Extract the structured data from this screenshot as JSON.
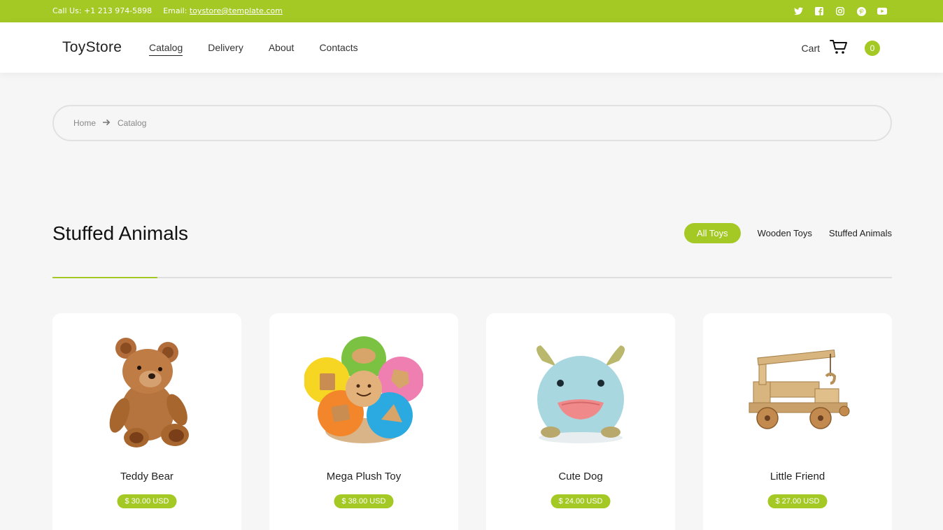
{
  "topbar": {
    "call_label": "Call Us: +1 213 974-5898",
    "email_prefix": "Email:",
    "email": "toystore@template.com",
    "social": [
      "twitter-icon",
      "facebook-icon",
      "instagram-icon",
      "pinterest-icon",
      "youtube-icon"
    ]
  },
  "header": {
    "logo": "ToyStore",
    "nav": [
      "Catalog",
      "Delivery",
      "About",
      "Contacts"
    ],
    "active_nav": "Catalog",
    "cart_label": "Cart",
    "cart_count": "0"
  },
  "breadcrumb": {
    "home": "Home",
    "current": "Catalog"
  },
  "section": {
    "title": "Stuffed Animals",
    "filters": [
      "All Toys",
      "Wooden Toys",
      "Stuffed Animals"
    ],
    "active_filter": "All Toys"
  },
  "products": [
    {
      "name": "Teddy Bear",
      "price": "$ 30.00 USD",
      "image": "teddy-bear-image"
    },
    {
      "name": "Mega Plush Toy",
      "price": "$ 38.00 USD",
      "image": "shape-sorter-image"
    },
    {
      "name": "Cute Dog",
      "price": "$ 24.00 USD",
      "image": "plush-monster-image"
    },
    {
      "name": "Little Friend",
      "price": "$ 27.00 USD",
      "image": "wooden-truck-image"
    }
  ],
  "colors": {
    "accent": "#a4c924",
    "background": "#f6f6f6"
  }
}
